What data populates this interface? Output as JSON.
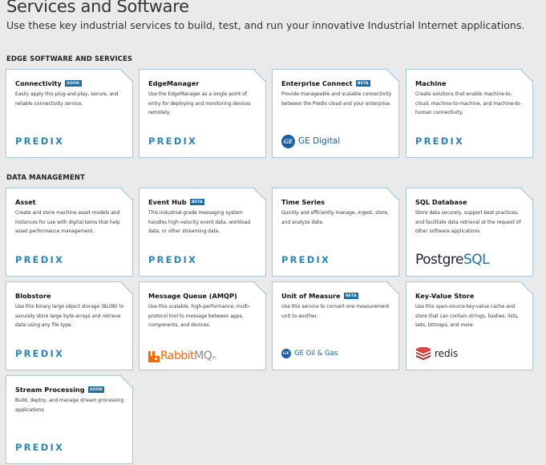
{
  "header": {
    "title": "Services and Software",
    "subtitle": "Use these key industrial services to build, test, and run your innovative Industrial Internet applications."
  },
  "sections": [
    {
      "title": "EDGE SOFTWARE AND SERVICES",
      "cards": [
        {
          "title": "Connectivity",
          "badge": "SOON",
          "desc": "Easily apply this plug-and-play, secure, and reliable connectivity service.",
          "logo": "PREDIX"
        },
        {
          "title": "EdgeManager",
          "badge": "",
          "desc": "Use the EdgeManager as a single point of entry for deploying and monitoring devices remotely.",
          "logo": "PREDIX"
        },
        {
          "title": "Enterprise Connect",
          "badge": "BETA",
          "desc": "Provide manageable and scalable connectivity between the Predix cloud and your enterprise.",
          "logo": "GE Digital"
        },
        {
          "title": "Machine",
          "badge": "",
          "desc": "Create solutions that enable machine-to-cloud, machine-to-machine, and machine-to-human connectivity.",
          "logo": "PREDIX"
        }
      ]
    },
    {
      "title": "DATA MANAGEMENT",
      "cards": [
        {
          "title": "Asset",
          "badge": "",
          "desc": "Create and store machine asset models and instances for use with digital twins that help asset performance management.",
          "logo": "PREDIX"
        },
        {
          "title": "Event Hub",
          "badge": "BETA",
          "desc": "This industrial-grade messaging system handles high-velocity event data, workload data, or other streaming data.",
          "logo": "PREDIX"
        },
        {
          "title": "Time Series",
          "badge": "",
          "desc": "Quickly and efficiently manage, ingest, store, and analyze data.",
          "logo": "PREDIX"
        },
        {
          "title": "SQL Database",
          "badge": "",
          "desc": "Store data securely, support best practices, and facilitate data retrieval at the request of other software applications.",
          "logo_a": "Postgre",
          "logo_b": "SQL"
        },
        {
          "title": "Blobstore",
          "badge": "",
          "desc": "Use this binary large object storage (BLOB) to securely store large byte arrays and retrieve data using any file type.",
          "logo": "PREDIX"
        },
        {
          "title": "Message Queue (AMQP)",
          "badge": "",
          "desc": "Use this scalable, high-performance, multi-protocol tool to message between apps, components, and devices.",
          "logo_a": "Rabbit",
          "logo_b": "MQ",
          "logo_c": "TM"
        },
        {
          "title": "Unit of Measure",
          "badge": "BETA",
          "desc": "Use this service to convert one measurement unit to another.",
          "logo": "GE Oil & Gas"
        },
        {
          "title": "Key-Value Store",
          "badge": "",
          "desc": "Use this open-source key-value cache and store that can contain strings, hashes, lists, sets, bitmaps, and more.",
          "logo": "redis"
        },
        {
          "title": "Stream Processing",
          "badge": "SOON",
          "desc": "Build, deploy, and manage stream processing applications.",
          "logo": "PREDIX"
        }
      ]
    }
  ],
  "ge_monogram": "GE"
}
